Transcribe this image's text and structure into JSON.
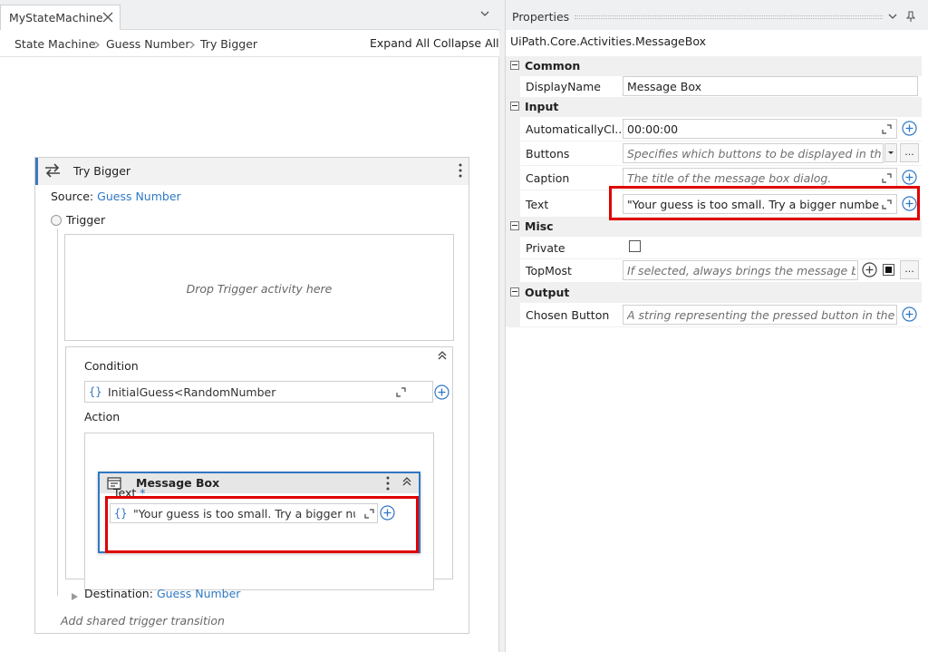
{
  "document_tab": {
    "title": "MyStateMachine"
  },
  "breadcrumb": {
    "items": [
      "State Machine",
      "Guess Number",
      "Try Bigger"
    ],
    "expand_all": "Expand All",
    "collapse_all": "Collapse All"
  },
  "state": {
    "title": "Try Bigger",
    "source_label": "Source:",
    "source_value": "Guess Number",
    "trigger_label": "Trigger",
    "trigger_drop_hint": "Drop Trigger activity here",
    "condition_label": "Condition",
    "condition_value": "InitialGuess<RandomNumber",
    "action_label": "Action",
    "destination_label": "Destination:",
    "destination_value": "Guess Number",
    "add_shared_trigger": "Add shared trigger transition"
  },
  "message_box": {
    "title": "Message Box",
    "text_label": "Text",
    "required_marker": "*",
    "text_value": "\"Your guess is too small. Try a bigger numb",
    "brace": "{}"
  },
  "properties": {
    "title": "Properties",
    "activity_type": "UiPath.Core.Activities.MessageBox",
    "categories": {
      "common": "Common",
      "input": "Input",
      "misc": "Misc",
      "output": "Output"
    },
    "rows": {
      "display_name": {
        "label": "DisplayName",
        "value": "Message Box"
      },
      "auto_close": {
        "label": "AutomaticallyCl...",
        "value": "00:00:00"
      },
      "buttons": {
        "label": "Buttons",
        "placeholder": "Specifies which buttons to be displayed in the mes"
      },
      "caption": {
        "label": "Caption",
        "placeholder": "The title of the message box dialog."
      },
      "text": {
        "label": "Text",
        "value": "\"Your guess is too small. Try a bigger number.\""
      },
      "private": {
        "label": "Private",
        "checked": false
      },
      "topmost": {
        "label": "TopMost",
        "placeholder": "If selected, always brings the message box to"
      },
      "chosen_button": {
        "label": "Chosen Button",
        "placeholder": "A string representing the pressed button in the messa"
      }
    },
    "ellipsis": "..."
  },
  "colors": {
    "accent": "#2f78c4",
    "highlight": "#e00000"
  }
}
